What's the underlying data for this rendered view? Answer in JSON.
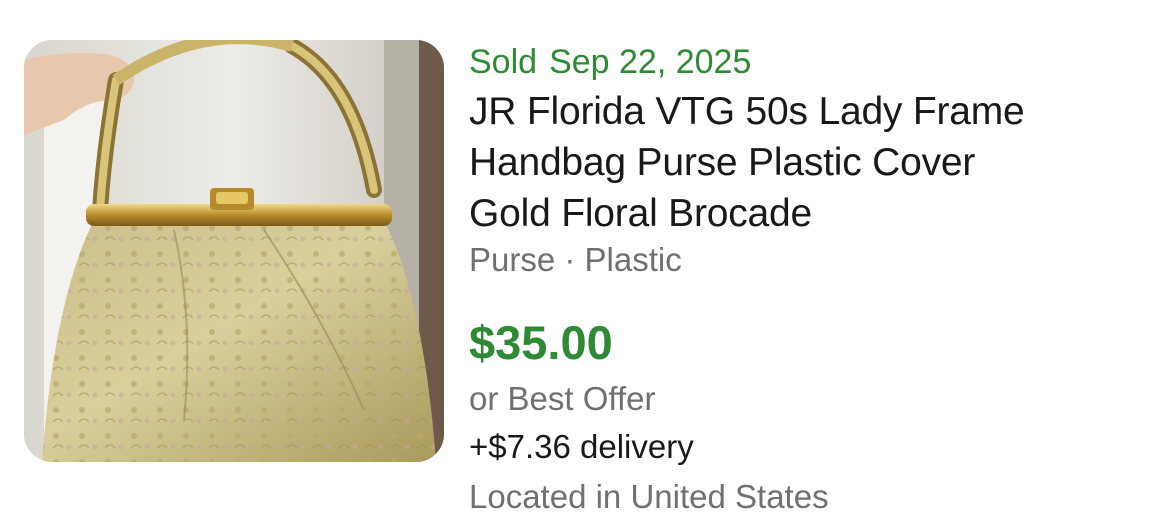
{
  "listing": {
    "image_alt": "Gold floral brocade handbag with gold frame and handle",
    "sold_label": "Sold",
    "sold_date": "Sep 22, 2025",
    "title_lines": [
      "JR Florida VTG  50s Lady Frame",
      "Handbag Purse Plastic Cover",
      "Gold Floral Brocade"
    ],
    "subtitle": "Purse · Plastic",
    "price": "$35.00",
    "offer": "or Best Offer",
    "delivery": "+$7.36 delivery",
    "location": "Located in United States"
  },
  "colors": {
    "sold_green": "#2f8a35",
    "text_dark": "#191919",
    "text_gray": "#707070"
  }
}
